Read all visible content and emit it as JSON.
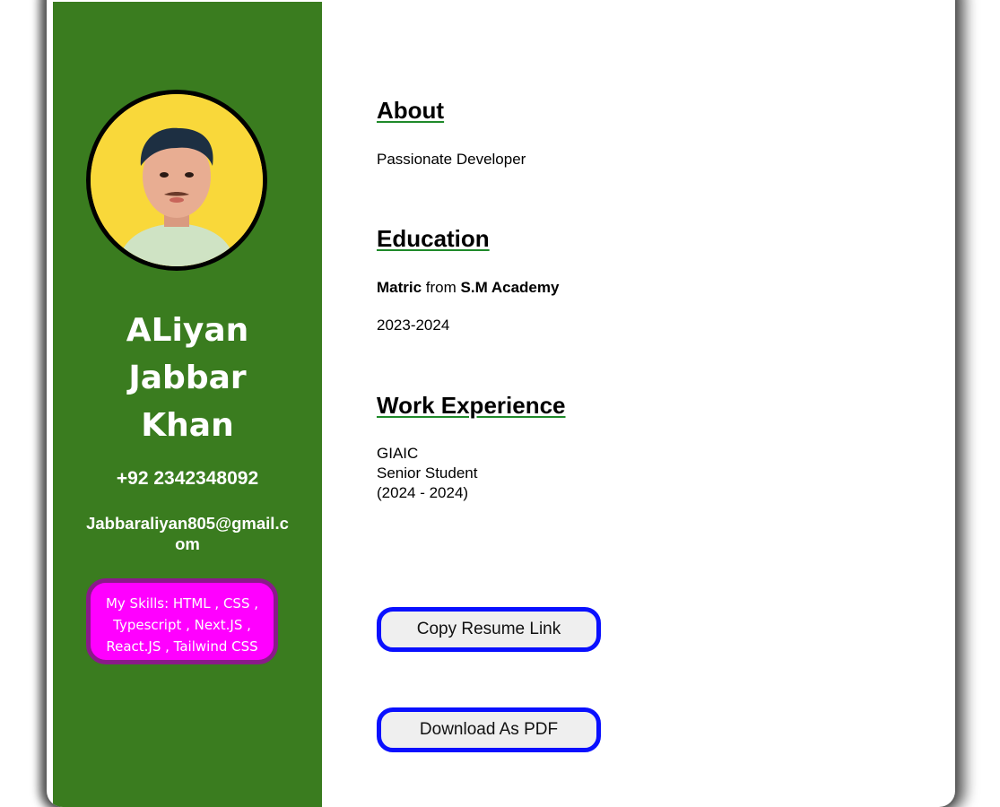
{
  "profile": {
    "name_line1": "ALiyan",
    "name_line2": "Jabbar",
    "name_line3": "Khan",
    "phone": "+92 2342348092",
    "email": "Jabbaraliyan805@gmail.com",
    "skills": "My Skills: HTML , CSS , Typescript , Next.JS , React.JS , Tailwind CSS"
  },
  "about": {
    "heading": "About",
    "text": "Passionate Developer"
  },
  "education": {
    "heading": "Education",
    "degree": "Matric",
    "connector": " from ",
    "institution": "S.M Academy",
    "years": "2023-2024"
  },
  "experience": {
    "heading": "Work Experience",
    "company": "GIAIC",
    "role": "Senior Student",
    "period": "(2024 - 2024)"
  },
  "actions": {
    "copy_label": "Copy Resume Link",
    "download_label": "Download As PDF"
  },
  "colors": {
    "sidebar": "#3a7c1f",
    "avatar_bg": "#f9d83a",
    "skills_bg": "#ff00ff",
    "skills_border": "#8a1a8a",
    "button_border": "#0a10ff",
    "heading_underline": "#1f8a2a"
  }
}
